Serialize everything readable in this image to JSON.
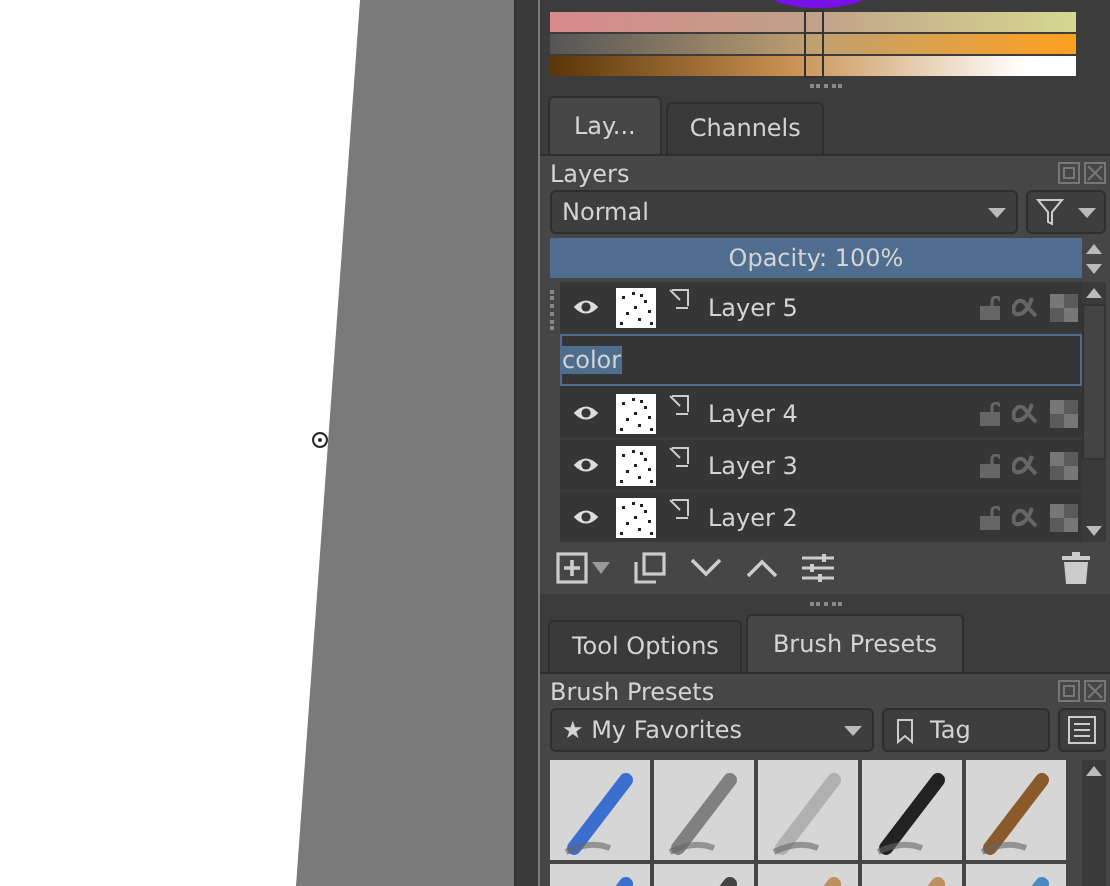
{
  "color_sliders": [
    {
      "level": 0.5
    },
    {
      "level": 0.5
    },
    {
      "level": 0.5
    }
  ],
  "top_tabs": [
    {
      "label": "Lay...",
      "selected": true
    },
    {
      "label": "Channels",
      "selected": false
    }
  ],
  "layers_panel": {
    "title": "Layers",
    "blend_mode": "Normal",
    "opacity": {
      "label": "Opacity:  100%",
      "level": 1
    },
    "layers": [
      {
        "kind": "layer",
        "name": "Layer 5",
        "visible": true
      },
      {
        "kind": "rename",
        "value": "color"
      },
      {
        "kind": "layer",
        "name": "Layer 4",
        "visible": true
      },
      {
        "kind": "layer",
        "name": "Layer 3",
        "visible": true
      },
      {
        "kind": "layer",
        "name": "Layer 2",
        "visible": true
      }
    ]
  },
  "bottom_tabs": [
    {
      "label": "Tool Options",
      "selected": false
    },
    {
      "label": "Brush Presets",
      "selected": true
    }
  ],
  "brush_presets": {
    "title": "Brush Presets",
    "tag": "★ My Favorites",
    "tag_button": "Tag"
  }
}
